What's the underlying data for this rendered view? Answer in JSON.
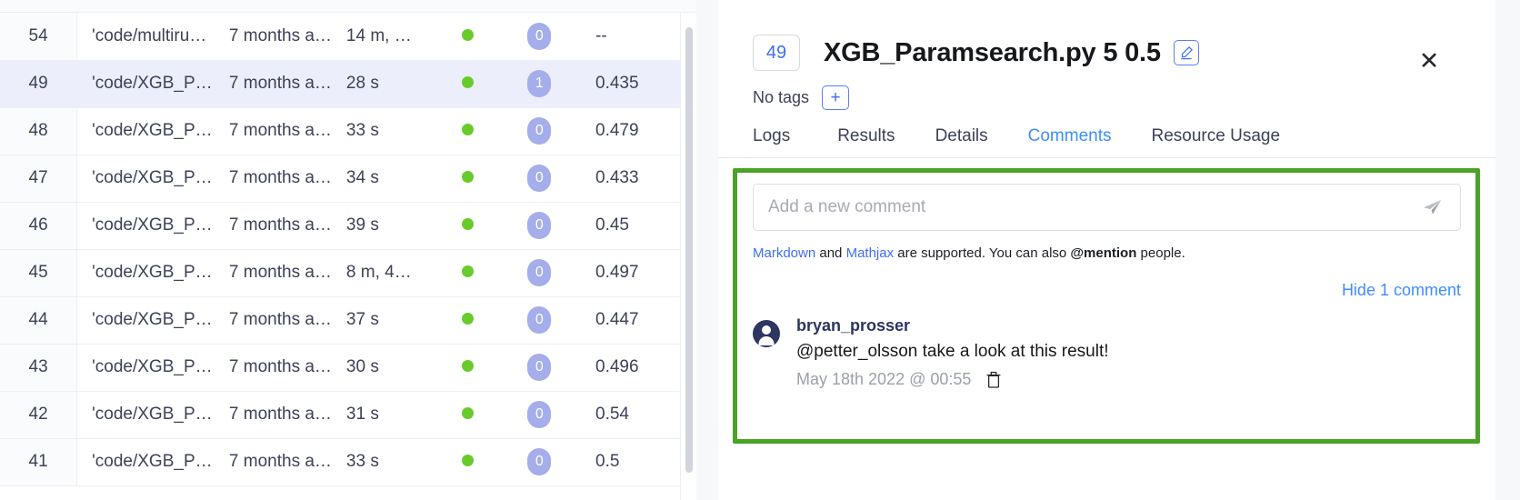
{
  "runs_table": {
    "columns": [
      "id",
      "name",
      "when",
      "duration",
      "status",
      "count",
      "value"
    ],
    "rows": [
      {
        "id": "54",
        "name": "'code/multiru…",
        "when": "7 months a…",
        "duration": "14 m, …",
        "status": "running-dot",
        "count": "0",
        "value": "--",
        "selected": false
      },
      {
        "id": "49",
        "name": "'code/XGB_P…",
        "when": "7 months a…",
        "duration": "28 s",
        "status": "running-dot",
        "count": "1",
        "value": "0.435",
        "selected": true
      },
      {
        "id": "48",
        "name": "'code/XGB_P…",
        "when": "7 months a…",
        "duration": "33 s",
        "status": "running-dot",
        "count": "0",
        "value": "0.479",
        "selected": false
      },
      {
        "id": "47",
        "name": "'code/XGB_P…",
        "when": "7 months a…",
        "duration": "34 s",
        "status": "running-dot",
        "count": "0",
        "value": "0.433",
        "selected": false
      },
      {
        "id": "46",
        "name": "'code/XGB_P…",
        "when": "7 months a…",
        "duration": "39 s",
        "status": "running-dot",
        "count": "0",
        "value": "0.45",
        "selected": false
      },
      {
        "id": "45",
        "name": "'code/XGB_P…",
        "when": "7 months a…",
        "duration": "8 m, 4…",
        "status": "running-dot",
        "count": "0",
        "value": "0.497",
        "selected": false
      },
      {
        "id": "44",
        "name": "'code/XGB_P…",
        "when": "7 months a…",
        "duration": "37 s",
        "status": "running-dot",
        "count": "0",
        "value": "0.447",
        "selected": false
      },
      {
        "id": "43",
        "name": "'code/XGB_P…",
        "when": "7 months a…",
        "duration": "30 s",
        "status": "running-dot",
        "count": "0",
        "value": "0.496",
        "selected": false
      },
      {
        "id": "42",
        "name": "'code/XGB_P…",
        "when": "7 months a…",
        "duration": "31 s",
        "status": "running-dot",
        "count": "0",
        "value": "0.54",
        "selected": false
      },
      {
        "id": "41",
        "name": "'code/XGB_P…",
        "when": "7 months a…",
        "duration": "33 s",
        "status": "running-dot",
        "count": "0",
        "value": "0.5",
        "selected": false
      }
    ]
  },
  "detail_panel": {
    "run_id": "49",
    "title": "XGB_Paramsearch.py 5 0.5",
    "edit_icon": "pencil-icon",
    "close_icon": "✕",
    "tags_label": "No tags",
    "add_tag_label": "+",
    "tabs": [
      {
        "label": "Logs",
        "active": false
      },
      {
        "label": "Results",
        "active": false
      },
      {
        "label": "Details",
        "active": false
      },
      {
        "label": "Comments",
        "active": true
      },
      {
        "label": "Resource Usage",
        "active": false
      }
    ],
    "comments": {
      "input_placeholder": "Add a new comment",
      "input_value": "",
      "send_icon": "send-paper-plane-icon",
      "hint": {
        "markdown_link": "Markdown",
        "and_text": " and ",
        "mathjax_link": "Mathjax",
        "supported_text": " are supported. You can also ",
        "mention_text": "@mention",
        "people_text": " people."
      },
      "hide_link": "Hide 1 comment",
      "list": [
        {
          "author": "bryan_prosser",
          "text": "@petter_olsson take a look at this result!",
          "date": "May 18th 2022 @ 00:55",
          "delete_icon": "trash-icon"
        }
      ]
    }
  },
  "annotations": {
    "highlight_color": "#4aa227",
    "tab_highlight_target": "Comments",
    "panel_highlight_target": "comments-panel"
  },
  "colors": {
    "accent_blue": "#3f6ef5",
    "tab_active_blue": "#3f8efc",
    "status_green": "#69cb2b",
    "count_pill": "#a5aeea",
    "selected_row": "#eceefb",
    "annotation_green": "#4aa227"
  }
}
